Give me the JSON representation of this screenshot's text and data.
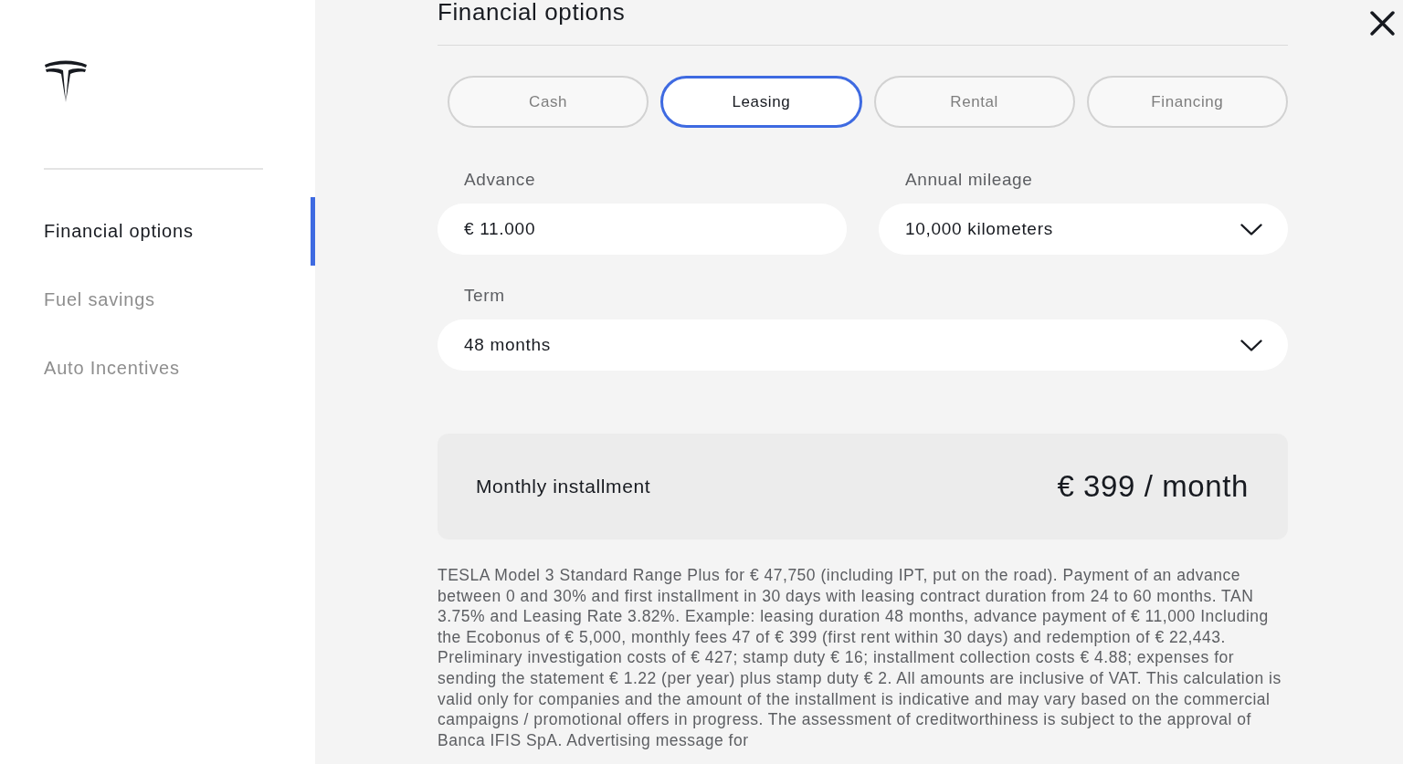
{
  "sidebar": {
    "items": [
      {
        "label": "Financial options",
        "selected": true
      },
      {
        "label": "Fuel savings",
        "selected": false
      },
      {
        "label": "Auto Incentives",
        "selected": false
      }
    ]
  },
  "page": {
    "title": "Financial options"
  },
  "tabs": [
    {
      "label": "Cash",
      "selected": false
    },
    {
      "label": "Leasing",
      "selected": true
    },
    {
      "label": "Rental",
      "selected": false
    },
    {
      "label": "Financing",
      "selected": false
    }
  ],
  "field_rows": [
    [
      {
        "kind": "input",
        "label": "Advance",
        "value": "€ 11.000"
      },
      {
        "kind": "select",
        "label": "Annual mileage",
        "value": "10,000 kilometers"
      }
    ],
    [
      {
        "kind": "select",
        "label": "Term",
        "value": "48 months"
      }
    ]
  ],
  "installment": {
    "label": "Monthly installment",
    "amount": "€ 399 / month"
  },
  "disclaimer": "TESLA Model 3 Standard Range Plus for € 47,750 (including IPT, put on the road). Payment of an advance between 0 and 30% and first installment in 30 days with leasing contract duration from 24 to 60 months. TAN 3.75% and Leasing Rate 3.82%. Example: leasing duration 48 months, advance payment of € 11,000 Including the Ecobonus of € 5,000, monthly fees 47 of € 399 (first rent within 30 days) and redemption of € 22,443. Preliminary investigation costs of € 427; stamp duty € 16; installment collection costs € 4.88; expenses for sending the statement € 1.22 (per year) plus stamp duty € 2. All amounts are inclusive of VAT. This calculation is valid only for companies and the amount of the installment is indicative and may vary based on the commercial campaigns / promotional offers in progress. The assessment of creditworthiness is subject to the approval of Banca IFIS SpA. Advertising message for"
}
